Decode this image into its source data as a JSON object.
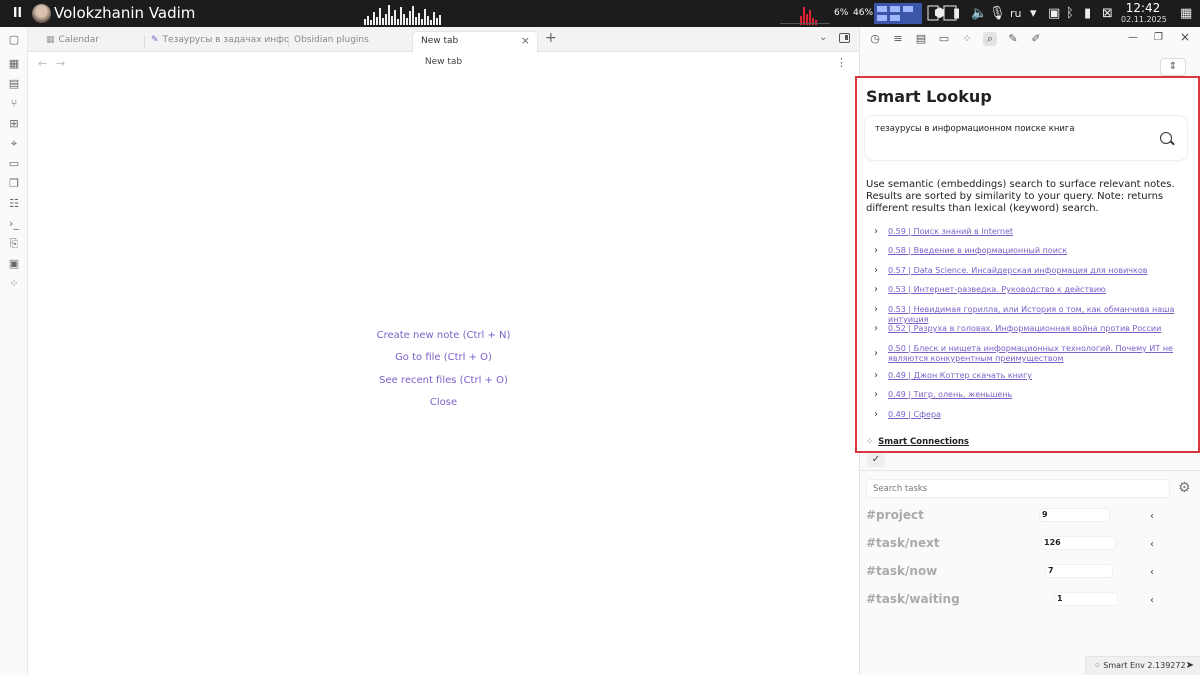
{
  "system_bar": {
    "logo": "ll",
    "username": "Volokzhanin Vadim",
    "cpu_percent": "6%",
    "mem_percent": "46%",
    "language": "ru",
    "time": "12:42",
    "date": "02.11.2025"
  },
  "tabs": [
    {
      "label": "Calendar",
      "icon": "calendar-icon"
    },
    {
      "label": "Тезаурусы в задачах инфор...",
      "icon": "pin-icon"
    },
    {
      "label": "Obsidian plugins",
      "icon": ""
    },
    {
      "label": "New tab",
      "icon": "",
      "active": true
    }
  ],
  "main": {
    "title": "New tab",
    "actions": {
      "create": "Create new note (Ctrl + N)",
      "goto": "Go to file (Ctrl + O)",
      "recent": "See recent files (Ctrl + O)",
      "close": "Close"
    }
  },
  "smart_lookup": {
    "title": "Smart Lookup",
    "query": "тезаурусы в информационном поиске книга",
    "description": "Use semantic (embeddings) search to surface relevant notes. Results are sorted by similarity to your query. Note: returns different results than lexical (keyword) search.",
    "results": [
      "0.59 | Поиск знаний в Internet",
      "0.58 | Введение в информационный поиск",
      "0.57 | Data Science. Инсайдерская информация для новичков",
      "0.53 | Интернет-разведка. Руководство к действию",
      "0.53 | Невидимая горилла, или История о том, как обманчива наша интуиция",
      "0.52 | Разруха в головах. Информационная война против России",
      "0.50 | Блеск и нищета информационных технологий. Почему ИТ не являются конкурентным преимуществом",
      "0.49 | Джон Коттер скачать книгу",
      "0.49 | Тигр, олень, женьшень",
      "0.49 | Сфера"
    ],
    "footer": "Smart Connections"
  },
  "tasks": {
    "search_placeholder": "Search tasks",
    "items": [
      {
        "tag": "#project",
        "count": "9"
      },
      {
        "tag": "#task/next",
        "count": "126"
      },
      {
        "tag": "#task/now",
        "count": "7"
      },
      {
        "tag": "#task/waiting",
        "count": "1"
      }
    ]
  },
  "status_bar": {
    "text": "Smart Env 2.139272"
  },
  "colors": {
    "accent": "#7b5fc9",
    "highlight_border": "#d9363e",
    "topbar": "#1c1c1c"
  }
}
